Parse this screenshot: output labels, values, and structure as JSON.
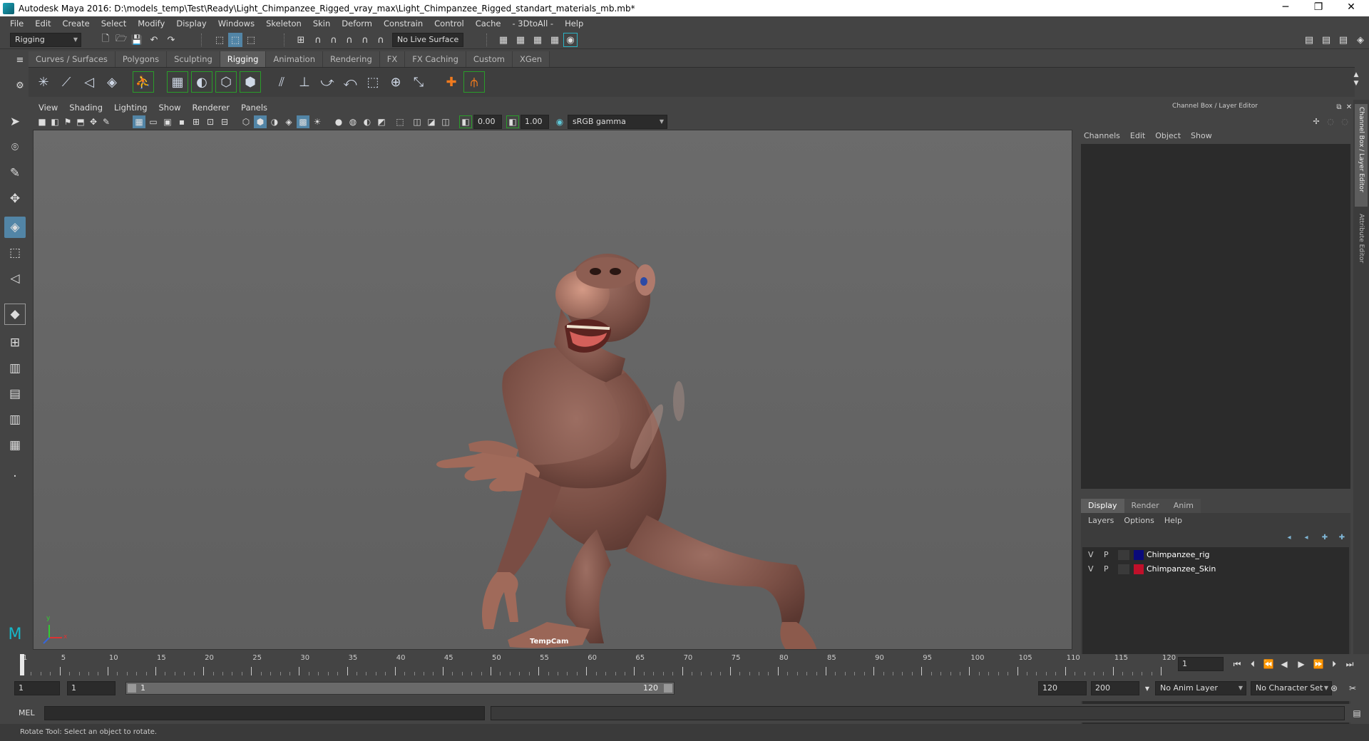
{
  "window": {
    "title": "Autodesk Maya 2016: D:\\models_temp\\Test\\Ready\\Light_Chimpanzee_Rigged_vray_max\\Light_Chimpanzee_Rigged_standart_materials_mb.mb*",
    "min": "─",
    "max": "❐",
    "close": "✕"
  },
  "menu": [
    "File",
    "Edit",
    "Create",
    "Select",
    "Modify",
    "Display",
    "Windows",
    "Skeleton",
    "Skin",
    "Deform",
    "Constrain",
    "Control",
    "Cache",
    "- 3DtoAll -",
    "Help"
  ],
  "status": {
    "mode": "Rigging",
    "live_surface": "No Live Surface"
  },
  "shelf_tabs": [
    "Curves / Surfaces",
    "Polygons",
    "Sculpting",
    "Rigging",
    "Animation",
    "Rendering",
    "FX",
    "FX Caching",
    "Custom",
    "XGen"
  ],
  "active_shelf": "Rigging",
  "viewport": {
    "menu": [
      "View",
      "Shading",
      "Lighting",
      "Show",
      "Renderer",
      "Panels"
    ],
    "exposure": "0.00",
    "gamma": "1.00",
    "color_space": "sRGB gamma",
    "camera_label": "TempCam",
    "axis_x": "x",
    "axis_y": "y"
  },
  "channel_box": {
    "title": "Channel Box / Layer Editor",
    "menu": [
      "Channels",
      "Edit",
      "Object",
      "Show"
    ]
  },
  "layer_editor": {
    "tabs": [
      "Display",
      "Render",
      "Anim"
    ],
    "active_tab": "Display",
    "menu": [
      "Layers",
      "Options",
      "Help"
    ],
    "layers": [
      {
        "v": "V",
        "p": "P",
        "name": "Chimpanzee_rig",
        "color": "#0a0a7a"
      },
      {
        "v": "V",
        "p": "P",
        "name": "Chimpanzee_Skin",
        "color": "#c0102a"
      }
    ]
  },
  "side_tabs": [
    "Channel Box / Layer Editor",
    "Attribute Editor"
  ],
  "timeline": {
    "ticks": [
      "1",
      "5",
      "10",
      "15",
      "20",
      "25",
      "30",
      "35",
      "40",
      "45",
      "50",
      "55",
      "60",
      "65",
      "70",
      "75",
      "80",
      "85",
      "90",
      "95",
      "100",
      "105",
      "110",
      "115",
      "120"
    ],
    "current_frame": "1",
    "playhead_frame": 1
  },
  "range": {
    "start": "1",
    "anim_start": "1",
    "slider_start": "1",
    "slider_end": "120",
    "anim_end": "120",
    "end": "200",
    "anim_layer": "No Anim Layer",
    "character_set": "No Character Set"
  },
  "mel_label": "MEL",
  "help_line": "Rotate Tool: Select an object to rotate."
}
